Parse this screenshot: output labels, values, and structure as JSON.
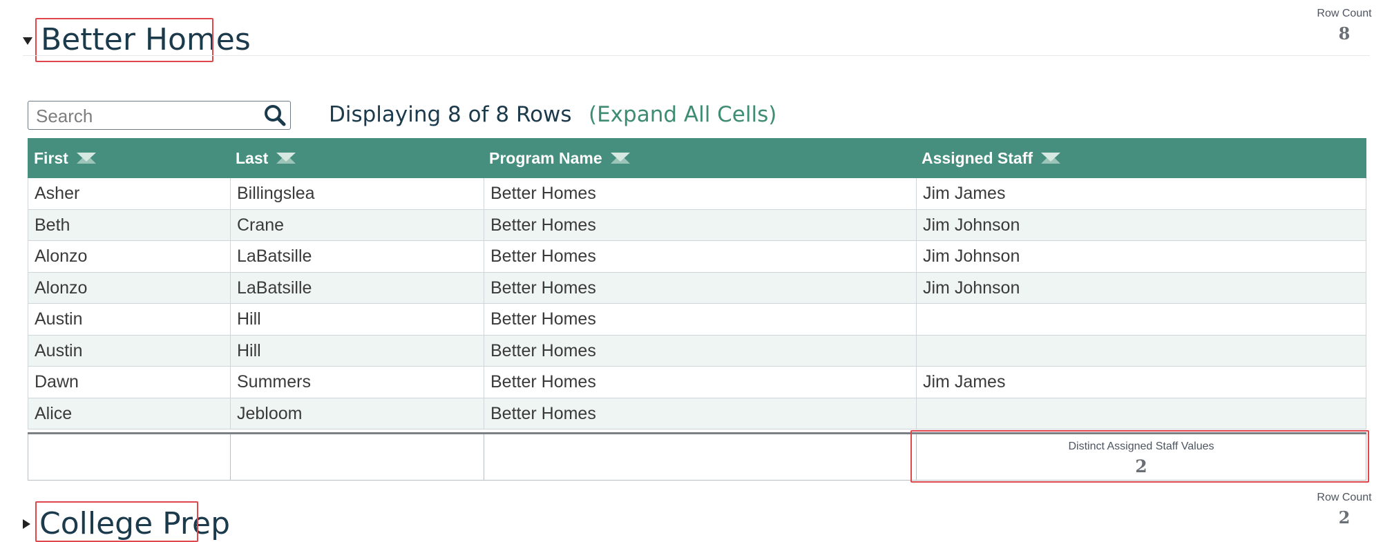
{
  "sections": [
    {
      "title": "Better Homes",
      "row_count_label": "Row Count",
      "row_count": "8",
      "expanded": true
    },
    {
      "title": "College Prep",
      "row_count_label": "Row Count",
      "row_count": "2",
      "expanded": false
    }
  ],
  "toolbar": {
    "search_placeholder": "Search",
    "displaying_text": "Displaying 8 of 8 Rows",
    "expand_link": "(Expand All Cells)"
  },
  "table": {
    "columns": [
      "First",
      "Last",
      "Program Name",
      "Assigned Staff"
    ],
    "rows": [
      [
        "Asher",
        "Billingslea",
        "Better Homes",
        "Jim James"
      ],
      [
        "Beth",
        "Crane",
        "Better Homes",
        "Jim Johnson"
      ],
      [
        "Alonzo",
        "LaBatsille",
        "Better Homes",
        "Jim Johnson"
      ],
      [
        "Alonzo",
        "LaBatsille",
        "Better Homes",
        "Jim Johnson"
      ],
      [
        "Austin",
        "Hill",
        "Better Homes",
        ""
      ],
      [
        "Austin",
        "Hill",
        "Better Homes",
        ""
      ],
      [
        "Dawn",
        "Summers",
        "Better Homes",
        "Jim James"
      ],
      [
        "Alice",
        "Jebloom",
        "Better Homes",
        ""
      ]
    ],
    "footer": {
      "aggregate_label": "Distinct Assigned Staff Values",
      "aggregate_value": "2"
    }
  },
  "colors": {
    "header_bg": "#468e7e",
    "row_alt": "#eef5f2",
    "title": "#1b3a4b",
    "link": "#3e8c72",
    "highlight": "#e0474c"
  },
  "icons": [
    "caret-down-icon",
    "caret-right-icon",
    "search-icon",
    "sort-icon"
  ]
}
